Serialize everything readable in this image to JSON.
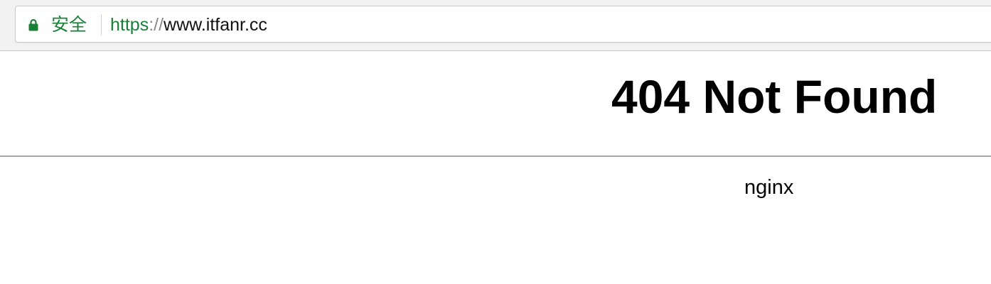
{
  "browser": {
    "security_label": "安全",
    "url": {
      "scheme": "https",
      "separator": "://",
      "host": "www.itfanr.cc"
    },
    "icons": {
      "security": "lock-icon"
    },
    "colors": {
      "secure": "#1a7f37",
      "url_text": "#111111",
      "toolbar_bg": "#f2f2f2"
    }
  },
  "page": {
    "title": "404 Not Found",
    "server": "nginx",
    "colors": {
      "text": "#000000",
      "rule": "#a6a6a6",
      "background": "#ffffff"
    }
  }
}
